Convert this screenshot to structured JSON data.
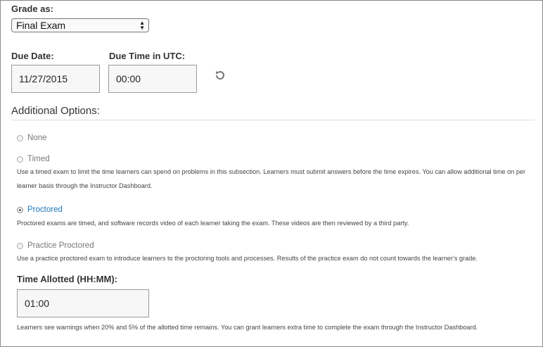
{
  "grade_as": {
    "label": "Grade as:",
    "selected": "Final Exam"
  },
  "due_date": {
    "label": "Due Date:",
    "value": "11/27/2015"
  },
  "due_time": {
    "label": "Due Time in UTC:",
    "value": "00:00"
  },
  "additional_options": {
    "title": "Additional Options:",
    "options": [
      {
        "label": "None",
        "selected": false,
        "description": ""
      },
      {
        "label": "Timed",
        "selected": false,
        "description": "Use a timed exam to limit the time learners can spend on problems in this subsection. Learners must submit answers before the time expires. You can allow additional time on per learner basis through the Instructor Dashboard."
      },
      {
        "label": "Proctored",
        "selected": true,
        "description": "Proctored exams are timed, and software records video of each learner taking the exam. These videos are then reviewed by a third party."
      },
      {
        "label": "Practice Proctored",
        "selected": false,
        "description": "Use a practice proctored exam to introduce learners to the proctoring tools and processes. Results of the practice exam do not count towards the learner's grade."
      }
    ]
  },
  "time_allotted": {
    "label": "Time Allotted (HH:MM):",
    "value": "01:00",
    "note": "Learners see warnings when 20% and 5% of the allotted time remains. You can grant learners extra time to complete the exam through the Instructor Dashboard."
  },
  "icons": {
    "reset": "reset-icon",
    "select_arrows": "select-arrows-icon"
  },
  "colors": {
    "selected_option": "#1b75bb"
  }
}
